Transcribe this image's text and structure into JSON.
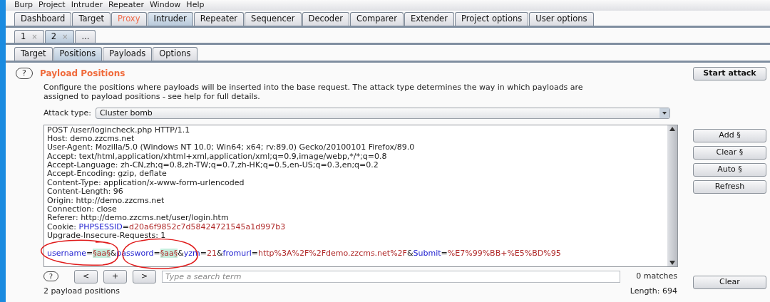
{
  "menu": [
    "Burp",
    "Project",
    "Intruder",
    "Repeater",
    "Window",
    "Help"
  ],
  "main_tabs": [
    {
      "label": "Dashboard",
      "selected": false,
      "highlighted": false
    },
    {
      "label": "Target",
      "selected": false,
      "highlighted": false
    },
    {
      "label": "Proxy",
      "selected": false,
      "highlighted": true
    },
    {
      "label": "Intruder",
      "selected": true,
      "highlighted": false
    },
    {
      "label": "Repeater",
      "selected": false,
      "highlighted": false
    },
    {
      "label": "Sequencer",
      "selected": false,
      "highlighted": false
    },
    {
      "label": "Decoder",
      "selected": false,
      "highlighted": false
    },
    {
      "label": "Comparer",
      "selected": false,
      "highlighted": false
    },
    {
      "label": "Extender",
      "selected": false,
      "highlighted": false
    },
    {
      "label": "Project options",
      "selected": false,
      "highlighted": false
    },
    {
      "label": "User options",
      "selected": false,
      "highlighted": false
    }
  ],
  "instance_tabs": [
    {
      "label": "1",
      "close": "×",
      "selected": false
    },
    {
      "label": "2",
      "close": "×",
      "selected": true
    },
    {
      "label": "...",
      "selected": false
    }
  ],
  "sub_tabs": [
    {
      "label": "Target",
      "selected": false
    },
    {
      "label": "Positions",
      "selected": true
    },
    {
      "label": "Payloads",
      "selected": false
    },
    {
      "label": "Options",
      "selected": false
    }
  ],
  "section": {
    "help": "?",
    "title": "Payload Positions",
    "description": "Configure the positions where payloads will be inserted into the base request. The attack type determines the way in which payloads are assigned to payload positions - see help for full details.",
    "start_button": "Start attack"
  },
  "attack_type": {
    "label": "Attack type:",
    "value": "Cluster bomb"
  },
  "request_headers": [
    [
      {
        "kind": "plain",
        "text": "POST /user/logincheck.php HTTP/1.1"
      }
    ],
    [
      {
        "kind": "plain",
        "text": "Host: demo.zzcms.net"
      }
    ],
    [
      {
        "kind": "plain",
        "text": "User-Agent: Mozilla/5.0 (Windows NT 10.0; Win64; x64; rv:89.0) Gecko/20100101 Firefox/89.0"
      }
    ],
    [
      {
        "kind": "plain",
        "text": "Accept: text/html,application/xhtml+xml,application/xml;q=0.9,image/webp,*/*;q=0.8"
      }
    ],
    [
      {
        "kind": "plain",
        "text": "Accept-Language: zh-CN,zh;q=0.8,zh-TW;q=0.7,zh-HK;q=0.5,en-US;q=0.3,en;q=0.2"
      }
    ],
    [
      {
        "kind": "plain",
        "text": "Accept-Encoding: gzip, deflate"
      }
    ],
    [
      {
        "kind": "plain",
        "text": "Content-Type: application/x-www-form-urlencoded"
      }
    ],
    [
      {
        "kind": "plain",
        "text": "Content-Length: 96"
      }
    ],
    [
      {
        "kind": "plain",
        "text": "Origin: http://demo.zzcms.net"
      }
    ],
    [
      {
        "kind": "plain",
        "text": "Connection: close"
      }
    ],
    [
      {
        "kind": "plain",
        "text": "Referer: http://demo.zzcms.net/user/login.htm"
      }
    ],
    [
      {
        "kind": "plain",
        "text": "Cookie: "
      },
      {
        "kind": "name",
        "text": "PHPSESSID"
      },
      {
        "kind": "plain",
        "text": "="
      },
      {
        "kind": "value",
        "text": "d20a6f9852c7d58424721545a1d997b3"
      }
    ],
    [
      {
        "kind": "plain",
        "text": "Upgrade-Insecure-Requests: 1"
      }
    ]
  ],
  "request_body": [
    {
      "kind": "name",
      "text": "username"
    },
    {
      "kind": "plain",
      "text": "="
    },
    {
      "kind": "payload",
      "text": "§aa§"
    },
    {
      "kind": "plain",
      "text": "&"
    },
    {
      "kind": "name",
      "text": "password"
    },
    {
      "kind": "plain",
      "text": "="
    },
    {
      "kind": "payload",
      "text": "§aa§"
    },
    {
      "kind": "plain",
      "text": "&"
    },
    {
      "kind": "name",
      "text": "yzm"
    },
    {
      "kind": "plain",
      "text": "="
    },
    {
      "kind": "value",
      "text": "21"
    },
    {
      "kind": "plain",
      "text": "&"
    },
    {
      "kind": "name",
      "text": "fromurl"
    },
    {
      "kind": "plain",
      "text": "="
    },
    {
      "kind": "value",
      "text": "http%3A%2F%2Fdemo.zzcms.net%2F"
    },
    {
      "kind": "plain",
      "text": "&"
    },
    {
      "kind": "name",
      "text": "Submit"
    },
    {
      "kind": "plain",
      "text": "="
    },
    {
      "kind": "value",
      "text": "%E7%99%BB+%E5%BD%95"
    }
  ],
  "side_buttons": [
    "Add §",
    "Clear §",
    "Auto §",
    "Refresh"
  ],
  "search": {
    "help": "?",
    "prev": "<",
    "add": "+",
    "next": ">",
    "placeholder": "Type a search term",
    "matches": "0 matches",
    "clear": "Clear"
  },
  "footer": {
    "positions": "2 payload positions",
    "length": "Length: 694"
  }
}
